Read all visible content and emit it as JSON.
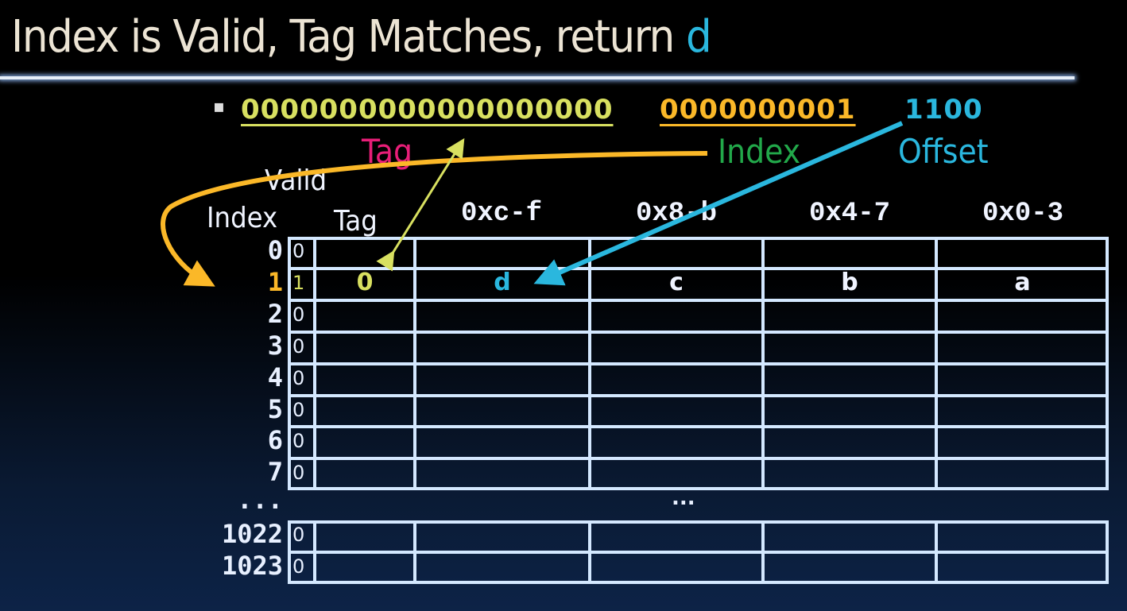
{
  "title": {
    "text": "Index is Valid, Tag Matches, return ",
    "highlight": "d"
  },
  "address": {
    "tag_bits": "0000000000000000000",
    "index_bits": "0000000001",
    "offset_bits": "1100",
    "bullet": "▪"
  },
  "field_labels": {
    "tag": "Tag",
    "index": "Index",
    "offset": "Offset"
  },
  "table": {
    "headers": {
      "valid": "Valid",
      "index": "Index",
      "tag": "Tag",
      "cols": [
        "0xc-f",
        "0x8-b",
        "0x4-7",
        "0x0-3"
      ]
    },
    "rows": [
      {
        "index": "0",
        "valid": "0",
        "tag": "",
        "data": [
          "",
          "",
          "",
          ""
        ]
      },
      {
        "index": "1",
        "valid": "1",
        "tag": "0",
        "data": [
          "d",
          "c",
          "b",
          "a"
        ]
      },
      {
        "index": "2",
        "valid": "0",
        "tag": "",
        "data": [
          "",
          "",
          "",
          ""
        ]
      },
      {
        "index": "3",
        "valid": "0",
        "tag": "",
        "data": [
          "",
          "",
          "",
          ""
        ]
      },
      {
        "index": "4",
        "valid": "0",
        "tag": "",
        "data": [
          "",
          "",
          "",
          ""
        ]
      },
      {
        "index": "5",
        "valid": "0",
        "tag": "",
        "data": [
          "",
          "",
          "",
          ""
        ]
      },
      {
        "index": "6",
        "valid": "0",
        "tag": "",
        "data": [
          "",
          "",
          "",
          ""
        ]
      },
      {
        "index": "7",
        "valid": "0",
        "tag": "",
        "data": [
          "",
          "",
          "",
          ""
        ]
      }
    ],
    "ellipsis_index": "...",
    "ellipsis_middle": "...",
    "tail_rows": [
      {
        "index": "1022",
        "valid": "0"
      },
      {
        "index": "1023",
        "valid": "0"
      }
    ]
  },
  "colors": {
    "tag_bits": "#d8e060",
    "index_bits": "#fbb828",
    "offset_bits": "#2ab7de",
    "tag_label": "#e81e78",
    "index_label": "#22a84a",
    "offset_label": "#2ab7de",
    "grid": "#d4e8ff"
  }
}
